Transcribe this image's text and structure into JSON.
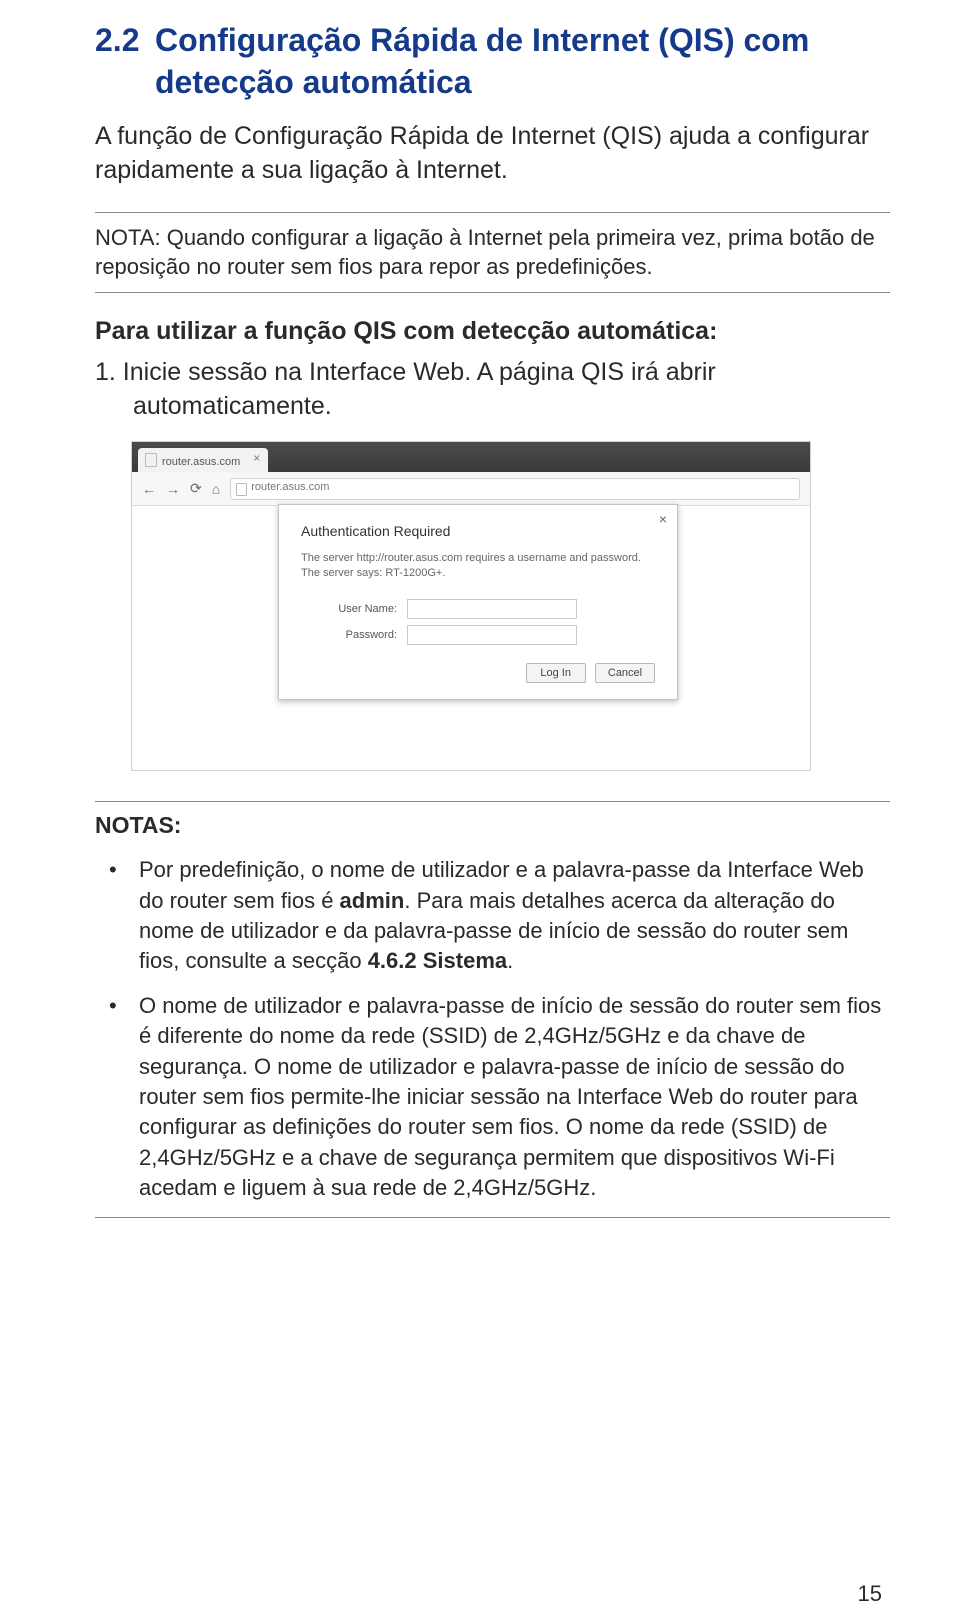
{
  "heading": {
    "number": "2.2",
    "line1": "Configuração Rápida de Internet (QIS) com",
    "line2": "detecção automática"
  },
  "intro": "A função de Configuração Rápida de Internet (QIS) ajuda a configurar rapidamente a sua ligação à Internet.",
  "note1": {
    "label": "NOTA",
    "text": ": Quando configurar a ligação à Internet pela primeira vez, prima botão de reposição no router sem fios para repor as predefinições."
  },
  "strongLine": "Para utilizar a função QIS com detecção automática:",
  "step1": "1. Inicie sessão na Interface Web. A página QIS irá abrir automaticamente.",
  "browser": {
    "tabTitle": "router.asus.com",
    "url": "router.asus.com",
    "dialog": {
      "title": "Authentication Required",
      "message": "The server http://router.asus.com requires a username and password. The server says: RT-1200G+.",
      "userLabel": "User Name:",
      "passLabel": "Password:",
      "loginBtn": "Log In",
      "cancelBtn": "Cancel"
    }
  },
  "notas": {
    "label": "NOTAS:",
    "items": [
      "Por predefinição, o nome de utilizador e a palavra-passe da Interface Web do router sem fios é <b>admin</b>. Para mais detalhes acerca da alteração do nome de utilizador e da palavra-passe de início de sessão do router sem fios, consulte a secção <b>4.6.2 Sistema</b>.",
      "O nome de utilizador e palavra-passe de início de sessão do router sem fios é diferente do nome da rede (SSID) de 2,4GHz/5GHz e da chave de segurança. O nome de utilizador e palavra-passe de início de sessão do router sem fios permite-lhe iniciar sessão na Interface Web do router para configurar as definições do router sem fios. O nome da rede (SSID) de 2,4GHz/5GHz e a chave de segurança permitem que dispositivos Wi-Fi acedam e liguem à sua rede de 2,4GHz/5GHz."
    ]
  },
  "pageNumber": "15"
}
